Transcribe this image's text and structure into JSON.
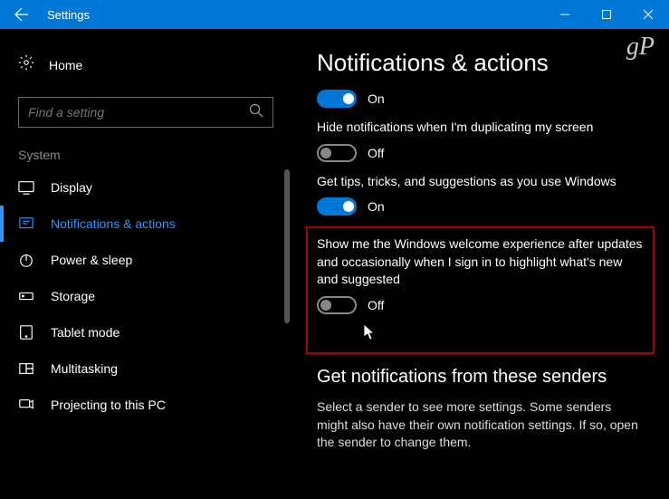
{
  "titlebar": {
    "title": "Settings"
  },
  "sidebar": {
    "home": "Home",
    "search_placeholder": "Find a setting",
    "category": "System",
    "items": [
      {
        "label": "Display",
        "icon": "display"
      },
      {
        "label": "Notifications & actions",
        "icon": "notifications",
        "selected": true
      },
      {
        "label": "Power & sleep",
        "icon": "power"
      },
      {
        "label": "Storage",
        "icon": "storage"
      },
      {
        "label": "Tablet mode",
        "icon": "tablet"
      },
      {
        "label": "Multitasking",
        "icon": "multitasking"
      },
      {
        "label": "Projecting to this PC",
        "icon": "projecting"
      }
    ]
  },
  "main": {
    "heading": "Notifications & actions",
    "toggles": [
      {
        "state": "On",
        "on": true
      },
      {
        "text": "Hide notifications when I'm duplicating my screen",
        "state": "Off",
        "on": false
      },
      {
        "text": "Get tips, tricks, and suggestions as you use Windows",
        "state": "On",
        "on": true
      },
      {
        "text": "Show me the Windows welcome experience after updates and occasionally when I sign in to highlight what's new and suggested",
        "state": "Off",
        "on": false,
        "highlighted": true
      }
    ],
    "section_heading": "Get notifications from these senders",
    "section_desc": "Select a sender to see more settings. Some senders might also have their own notification settings. If so, open the sender to change them."
  },
  "watermark": "gP"
}
